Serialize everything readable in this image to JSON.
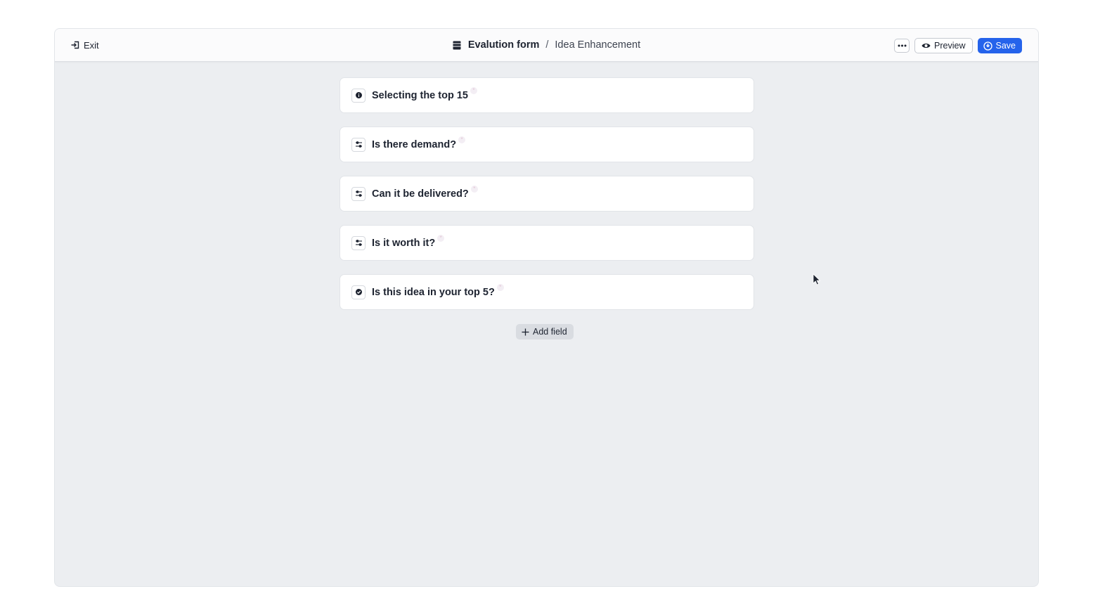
{
  "header": {
    "exit_label": "Exit",
    "form_title": "Evalution form",
    "separator": "/",
    "subtitle": "Idea Enhancement",
    "preview_label": "Preview",
    "save_label": "Save"
  },
  "fields": [
    {
      "label": "Selecting the top 15",
      "icon": "info-icon",
      "required_mark": "*"
    },
    {
      "label": "Is there demand?",
      "icon": "sliders-icon",
      "required_mark": "*"
    },
    {
      "label": "Can it be delivered?",
      "icon": "sliders-icon",
      "required_mark": "*"
    },
    {
      "label": "Is it worth it?",
      "icon": "sliders-icon",
      "required_mark": "*"
    },
    {
      "label": "Is this idea in your top 5?",
      "icon": "check-circle-icon",
      "required_mark": "*"
    }
  ],
  "add_field_label": "Add field",
  "colors": {
    "primary": "#2563eb",
    "canvas": "#eceef1",
    "text": "#1d2330"
  }
}
